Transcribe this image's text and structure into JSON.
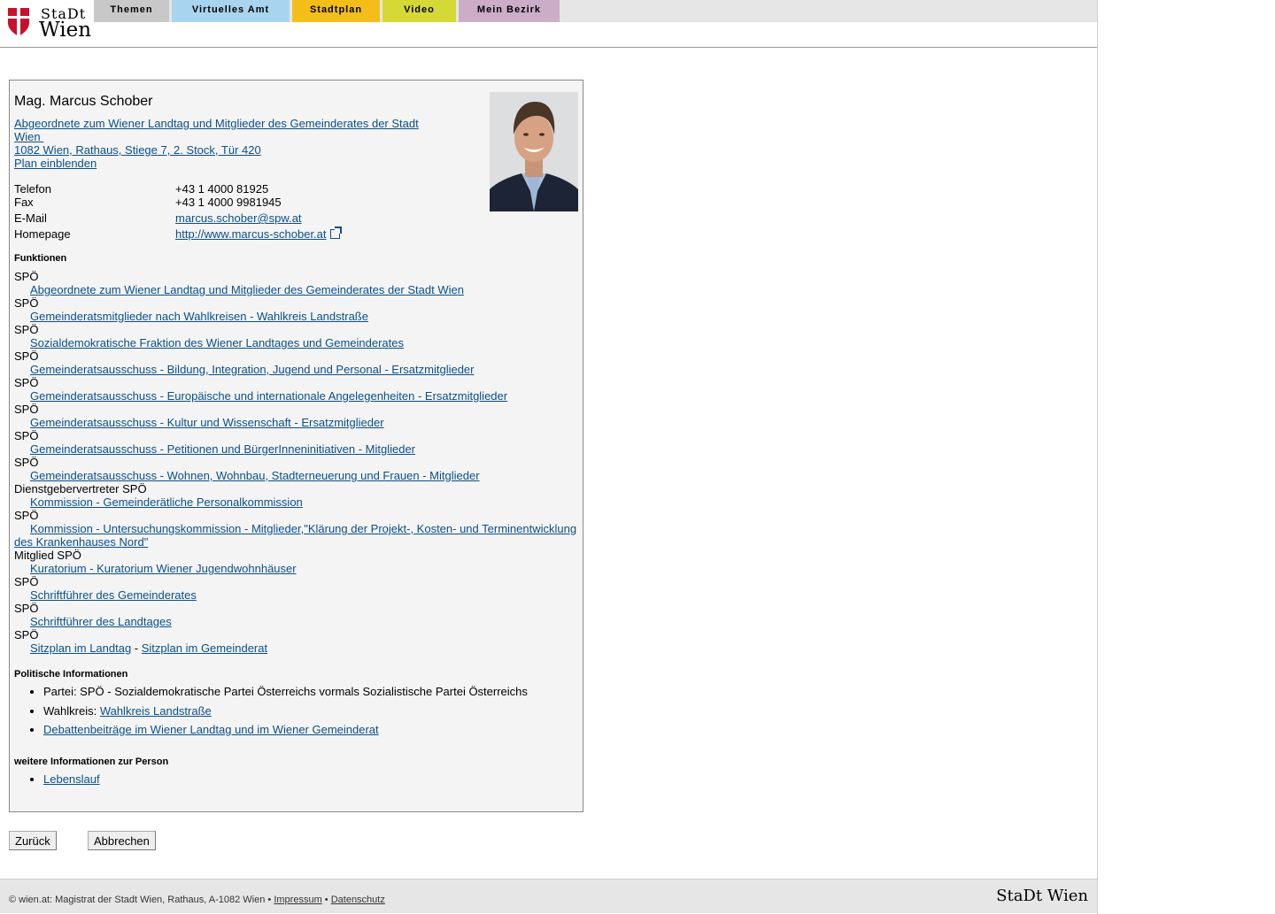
{
  "header": {
    "logo_stadt": "StaDt",
    "logo_wien": "Wien",
    "nav": [
      {
        "label": "Themen",
        "color": "#c8c8c8"
      },
      {
        "label": "Virtuelles Amt",
        "color": "#a9d4ef"
      },
      {
        "label": "Stadtplan",
        "color": "#f4bd1a"
      },
      {
        "label": "Video",
        "color": "#d6d935"
      },
      {
        "label": "Mein Bezirk",
        "color": "#ccadc8"
      }
    ]
  },
  "person": {
    "name": "Mag. Marcus Schober",
    "role_link_line1": "Abgeordnete zum Wiener Landtag und Mitglieder des Gemeinderates der Stadt",
    "role_link_line2": "Wien",
    "address": "1082 Wien, Rathaus, Stiege 7, 2. Stock, Tür 420",
    "plan_link": "Plan einblenden"
  },
  "contact": {
    "telefon_label": "Telefon",
    "telefon": "+43 1 4000 81925",
    "fax_label": "Fax",
    "fax": "+43 1 4000 9981945",
    "email_label": "E-Mail",
    "email": "marcus.schober@spw.at",
    "homepage_label": "Homepage",
    "homepage": "http://www.marcus-schober.at"
  },
  "funktionen": {
    "heading": "Funktionen",
    "items": [
      {
        "role": "SPÖ",
        "link": "Abgeordnete zum Wiener Landtag und Mitglieder des Gemeinderates der Stadt Wien"
      },
      {
        "role": "SPÖ",
        "link": "Gemeinderatsmitglieder nach Wahlkreisen - Wahlkreis Landstraße"
      },
      {
        "role": "SPÖ",
        "link": "Sozialdemokratische Fraktion des Wiener Landtages und Gemeinderates"
      },
      {
        "role": "SPÖ",
        "link": "Gemeinderatsausschuss - Bildung, Integration, Jugend und Personal - Ersatzmitglieder"
      },
      {
        "role": "SPÖ",
        "link": "Gemeinderatsausschuss - Europäische und internationale Angelegenheiten - Ersatzmitglieder"
      },
      {
        "role": "SPÖ",
        "link": "Gemeinderatsausschuss - Kultur und Wissenschaft - Ersatzmitglieder"
      },
      {
        "role": "SPÖ",
        "link": "Gemeinderatsausschuss - Petitionen und BürgerInneninitiativen - Mitglieder"
      },
      {
        "role": "SPÖ",
        "link": "Gemeinderatsausschuss - Wohnen, Wohnbau, Stadterneuerung und Frauen - Mitglieder"
      },
      {
        "role": "Dienstgebervertreter SPÖ",
        "link": "Kommission - Gemeinderätliche Personalkommission"
      },
      {
        "role": "SPÖ",
        "link": "Kommission - Untersuchungskommission - Mitglieder,\"Klärung der Projekt-, Kosten- und Terminentwicklung des Krankenhauses Nord\""
      },
      {
        "role": "Mitglied SPÖ",
        "link": "Kuratorium - Kuratorium Wiener Jugendwohnhäuser"
      },
      {
        "role": "SPÖ",
        "link": "Schriftführer des Gemeinderates"
      },
      {
        "role": "SPÖ",
        "link": "Schriftführer des Landtages"
      }
    ],
    "last_role": "SPÖ",
    "sitzplan_landtag": "Sitzplan im Landtag",
    "sitzplan_separator": " - ",
    "sitzplan_gemeinderat": "Sitzplan im Gemeinderat"
  },
  "politisch": {
    "heading": "Politische Informationen",
    "partei": "Partei: SPÖ - Sozialdemokratische Partei Österreichs vormals Sozialistische Partei Österreichs",
    "wahlkreis_label": "Wahlkreis: ",
    "wahlkreis_link": "Wahlkreis Landstraße",
    "debatten_link": "Debattenbeiträge im Wiener Landtag und im Wiener Gemeinderat"
  },
  "weitere": {
    "heading": "weitere Informationen zur Person",
    "lebenslauf": "Lebenslauf"
  },
  "buttons": {
    "zurueck": "Zurück",
    "abbrechen": "Abbrechen"
  },
  "footer": {
    "text": "© wien.at: Magistrat der Stadt Wien, Rathaus, A-1082 Wien • ",
    "impressum": "Impressum",
    "sep": " • ",
    "datenschutz": "Datenschutz",
    "logo": "StaDt Wien"
  },
  "colors": {
    "link": "#0a4f8a",
    "shield_red": "#c8102e"
  }
}
